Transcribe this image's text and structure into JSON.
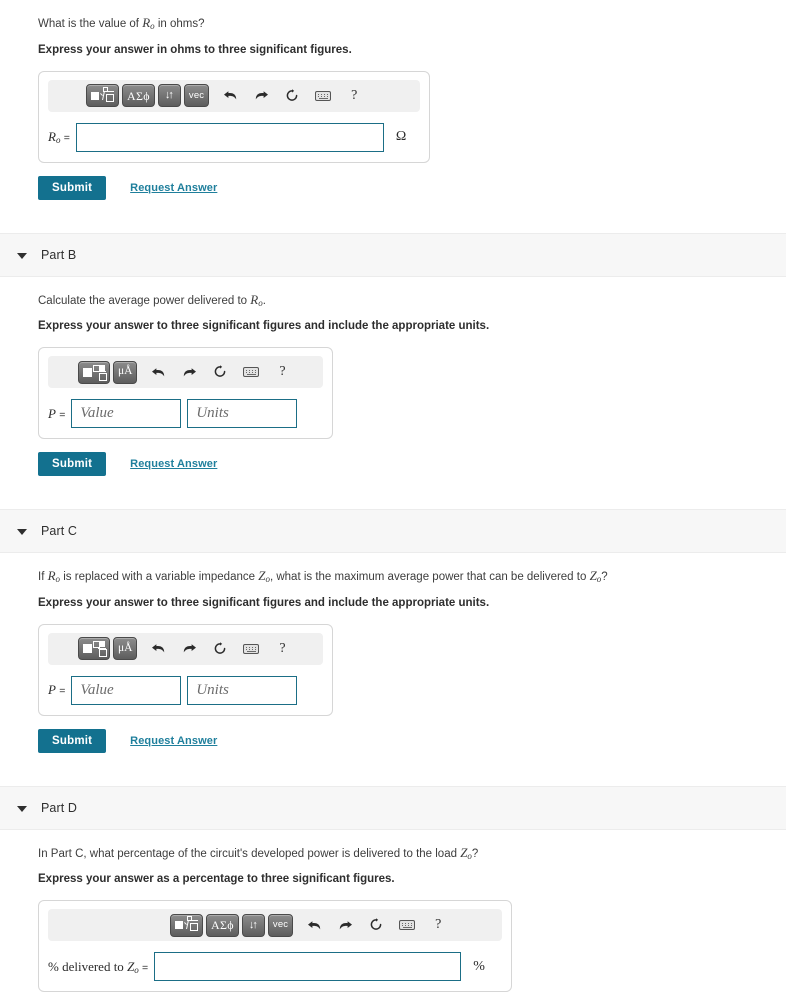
{
  "parts": [
    {
      "id": "part-a",
      "header": null,
      "question_pre": "What is the value of ",
      "question_sym": "R",
      "question_sym_sub": "o",
      "question_post": " in ohms?",
      "instruction": "Express your answer in ohms to three significant figures.",
      "toolbar_type": "symbolic",
      "input_type": "single",
      "var_label_sym": "R",
      "var_label_sub": "o",
      "var_label_eq": "=",
      "input_value": "",
      "input_placeholder": "",
      "unit_suffix": "Ω",
      "submit_label": "Submit",
      "request_label": "Request Answer",
      "has_submit": true
    },
    {
      "id": "part-b",
      "header": "Part B",
      "question_pre": "Calculate the average power delivered to ",
      "question_sym": "R",
      "question_sym_sub": "o",
      "question_post": ".",
      "instruction": "Express your answer to three significant figures and include the appropriate units.",
      "toolbar_type": "units",
      "input_type": "value-units",
      "var_label_sym": "P",
      "var_label_sub": "",
      "var_label_eq": "=",
      "value_placeholder": "Value",
      "units_placeholder": "Units",
      "value_value": "",
      "units_value": "",
      "submit_label": "Submit",
      "request_label": "Request Answer",
      "has_submit": true
    },
    {
      "id": "part-c",
      "header": "Part C",
      "question_pre": "If ",
      "question_sym": "R",
      "question_sym_sub": "o",
      "question_mid": " is replaced with a variable impedance ",
      "question_sym2": "Z",
      "question_sym2_sub": "o",
      "question_mid2": ", what is the maximum average power that can be delivered to ",
      "question_sym3": "Z",
      "question_sym3_sub": "o",
      "question_post": "?",
      "instruction": "Express your answer to three significant figures and include the appropriate units.",
      "toolbar_type": "units",
      "input_type": "value-units",
      "var_label_sym": "P",
      "var_label_sub": "",
      "var_label_eq": "=",
      "value_placeholder": "Value",
      "units_placeholder": "Units",
      "value_value": "",
      "units_value": "",
      "submit_label": "Submit",
      "request_label": "Request Answer",
      "has_submit": true
    },
    {
      "id": "part-d",
      "header": "Part D",
      "question_pre": "In Part C, what percentage of the circuit's developed power is delivered to the load ",
      "question_sym": "Z",
      "question_sym_sub": "o",
      "question_post": "?",
      "instruction": "Express your answer as a percentage to three significant figures.",
      "toolbar_type": "symbolic",
      "input_type": "single",
      "var_label_prefix": "% delivered to ",
      "var_label_sym": "Z",
      "var_label_sub": "o",
      "var_label_eq": "=",
      "input_value": "",
      "input_placeholder": "",
      "unit_suffix": "%",
      "has_submit": false
    }
  ],
  "toolbars": {
    "symbolic": {
      "buttons": [
        {
          "name": "template-root-button",
          "label": ""
        },
        {
          "name": "greek-symbols-button",
          "label": "ΑΣϕ"
        },
        {
          "name": "sort-arrows-button",
          "label": "↓↑"
        },
        {
          "name": "vector-button",
          "label": "vec"
        }
      ]
    },
    "units": {
      "buttons": [
        {
          "name": "template-fraction-button",
          "label": ""
        },
        {
          "name": "micro-angstrom-button",
          "label": "μÅ"
        }
      ]
    },
    "plain_icons": [
      {
        "name": "undo-icon",
        "label": "undo"
      },
      {
        "name": "redo-icon",
        "label": "redo"
      },
      {
        "name": "reset-icon",
        "label": "reset"
      },
      {
        "name": "keyboard-icon",
        "label": "keyboard shortcuts"
      },
      {
        "name": "help-icon",
        "label": "?"
      }
    ]
  },
  "colors": {
    "submit_bg": "#13718f",
    "link": "#1f7f9c",
    "input_border": "#1b6e86",
    "header_bg": "#f7f7f7",
    "toolbar_bg": "#f0f0f0"
  }
}
